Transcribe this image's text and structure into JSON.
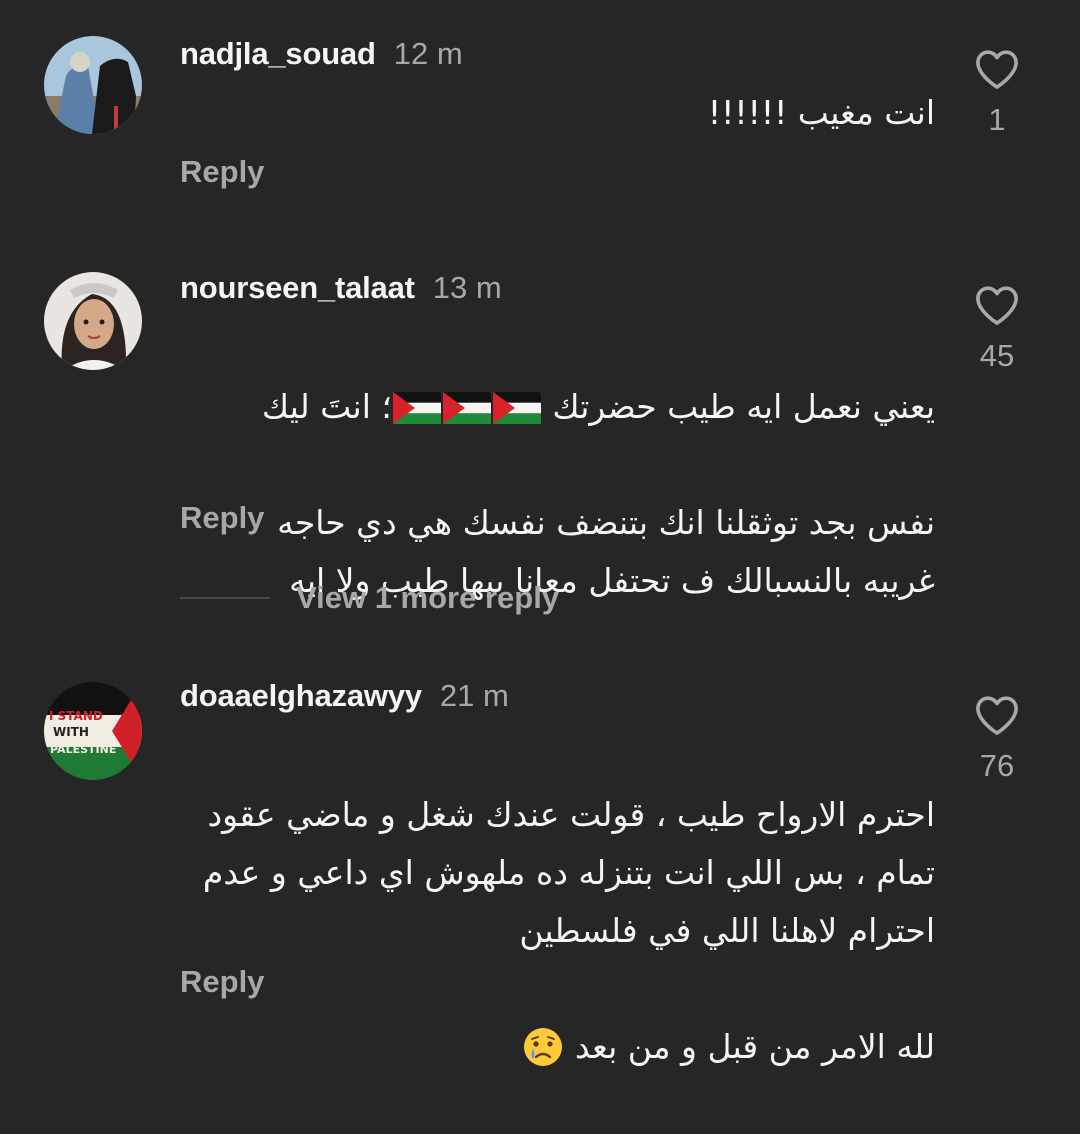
{
  "comments": [
    {
      "username": "nadjla_souad",
      "time": "12 m",
      "text": "انت مغيب !!!!!!",
      "likes": "1",
      "reply_label": "Reply"
    },
    {
      "username": "nourseen_talaat",
      "time": "13 m",
      "text_line1_start": "يعني نعمل ايه طيب حضرتك",
      "text_line1_end": "؛ انتَ ليك",
      "text_rest": "نفس بجد توثقلنا انك بتنضف نفسك هي دي حاجه\nغريبه بالنسبالك ف تحتفل معانا بيها طيب ولا ايه",
      "likes": "45",
      "reply_label": "Reply",
      "view_more_label": "View 1 more reply"
    },
    {
      "username": "doaaelghazawyy",
      "time": "21 m",
      "text": "احترم الارواح طيب ، قولت عندك شغل و ماضي عقود\nتمام ، بس اللي انت بتنزله ده ملهوش اي داعي و عدم\nاحترام لاهلنا اللي في فلسطين",
      "text_last": "لله الامر من قبل و من بعد",
      "likes": "76",
      "reply_label": "Reply",
      "avatar_text": [
        "I STAND",
        "WITH",
        "PALESTINE"
      ]
    }
  ],
  "icons": {
    "like": "heart-outline-icon",
    "flag": "palestine-flag-emoji",
    "crying": "crying-face-emoji"
  },
  "colors": {
    "background": "#262626",
    "primary_text": "#f5f5f5",
    "secondary_text": "#a8a8a8"
  }
}
